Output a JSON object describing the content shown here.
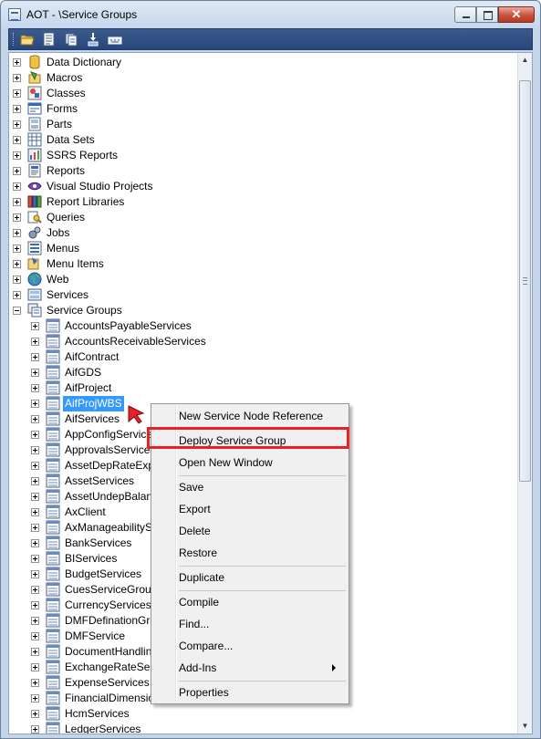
{
  "window": {
    "title": "AOT - \\Service Groups"
  },
  "toolbar": {
    "buttons": [
      "open-icon",
      "properties-icon",
      "compile-icon",
      "import-icon",
      "keyboard-icon"
    ]
  },
  "tree": {
    "root_items": [
      {
        "label": "Data Dictionary",
        "icon": "cylinder-icon",
        "expanded": false
      },
      {
        "label": "Macros",
        "icon": "macros-icon",
        "expanded": false
      },
      {
        "label": "Classes",
        "icon": "classes-icon",
        "expanded": false
      },
      {
        "label": "Forms",
        "icon": "forms-icon",
        "expanded": false
      },
      {
        "label": "Parts",
        "icon": "parts-icon",
        "expanded": false
      },
      {
        "label": "Data Sets",
        "icon": "datasets-icon",
        "expanded": false
      },
      {
        "label": "SSRS Reports",
        "icon": "ssrs-icon",
        "expanded": false
      },
      {
        "label": "Reports",
        "icon": "reports-icon",
        "expanded": false
      },
      {
        "label": "Visual Studio Projects",
        "icon": "visual-studio-icon",
        "expanded": false
      },
      {
        "label": "Report Libraries",
        "icon": "report-libraries-icon",
        "expanded": false
      },
      {
        "label": "Queries",
        "icon": "queries-icon",
        "expanded": false
      },
      {
        "label": "Jobs",
        "icon": "jobs-icon",
        "expanded": false
      },
      {
        "label": "Menus",
        "icon": "menus-icon",
        "expanded": false
      },
      {
        "label": "Menu Items",
        "icon": "menu-items-icon",
        "expanded": false
      },
      {
        "label": "Web",
        "icon": "globe-icon",
        "expanded": false
      },
      {
        "label": "Services",
        "icon": "services-icon",
        "expanded": false
      },
      {
        "label": "Service Groups",
        "icon": "service-groups-icon",
        "expanded": true
      }
    ],
    "children": [
      "AccountsPayableServices",
      "AccountsReceivableServices",
      "AifContract",
      "AifGDS",
      "AifProject",
      "AifProjWBS",
      "AifServices",
      "AppConfigServices",
      "ApprovalsServices",
      "AssetDepRateExpl",
      "AssetServices",
      "AssetUndepBalance",
      "AxClient",
      "AxManageabilityServices",
      "BankServices",
      "BIServices",
      "BudgetServices",
      "CuesServiceGroup",
      "CurrencyServices",
      "DMFDefinationGroup",
      "DMFService",
      "DocumentHandling",
      "ExchangeRateServices",
      "ExpenseServices",
      "FinancialDimensions",
      "HcmServices",
      "LedgerServices"
    ],
    "selected_child": "AifProjWBS"
  },
  "context_menu": {
    "items": [
      {
        "label": "New Service Node Reference"
      },
      {
        "label": "Deploy Service Group",
        "highlighted": true
      },
      {
        "label": "Open New Window"
      },
      {
        "label": "Save"
      },
      {
        "label": "Export"
      },
      {
        "label": "Delete"
      },
      {
        "label": "Restore"
      },
      {
        "label": "Duplicate"
      },
      {
        "label": "Compile"
      },
      {
        "label": "Find..."
      },
      {
        "label": "Compare..."
      },
      {
        "label": "Add-Ins",
        "submenu": true
      },
      {
        "label": "Properties"
      }
    ]
  },
  "colors": {
    "selection": "#3399ff",
    "highlight_box": "#e8202a",
    "toolbar": "#2f4f83"
  }
}
